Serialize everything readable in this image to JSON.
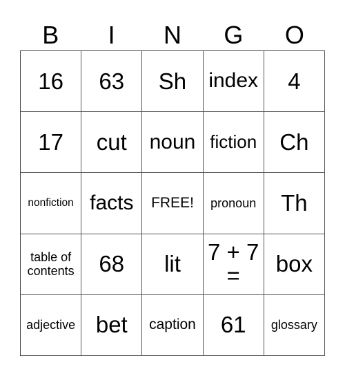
{
  "header": [
    "B",
    "I",
    "N",
    "G",
    "O"
  ],
  "cells": [
    [
      "16",
      "63",
      "Sh",
      "index",
      "4"
    ],
    [
      "17",
      "cut",
      "noun",
      "fiction",
      "Ch"
    ],
    [
      "nonfiction",
      "facts",
      "FREE!",
      "pronoun",
      "Th"
    ],
    [
      "table of contents",
      "68",
      "lit",
      "7 + 7 =",
      "box"
    ],
    [
      "adjective",
      "bet",
      "caption",
      "61",
      "glossary"
    ]
  ]
}
